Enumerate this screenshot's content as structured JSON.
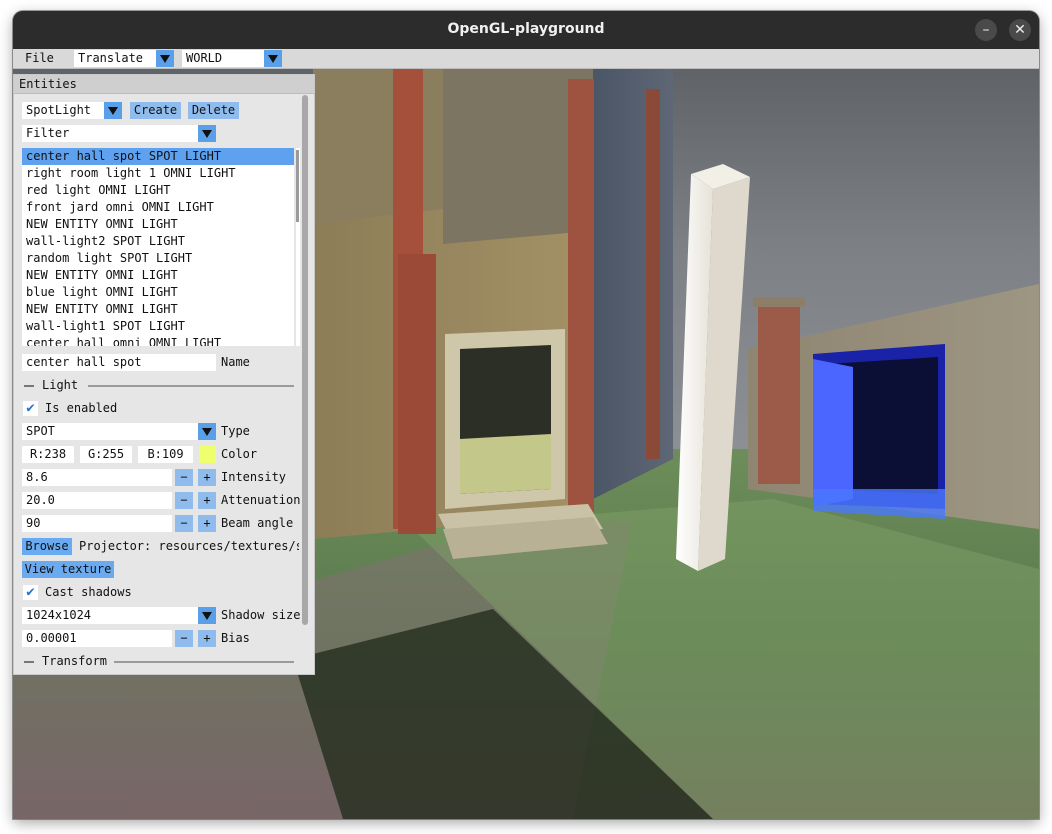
{
  "window": {
    "title": "OpenGL-playground",
    "minimize": "–",
    "close": "✕"
  },
  "menubar": {
    "file": "File",
    "mode": "Translate",
    "space": "WORLD"
  },
  "panel": {
    "title": "Entities",
    "entity_type": "SpotLight",
    "create": "Create",
    "delete": "Delete",
    "filter": "Filter",
    "entities": [
      "center hall spot SPOT LIGHT",
      "right room light 1 OMNI LIGHT",
      "red light OMNI LIGHT",
      "front jard omni OMNI LIGHT",
      "NEW ENTITY OMNI LIGHT",
      "wall-light2 SPOT LIGHT",
      "random light SPOT LIGHT",
      "NEW ENTITY OMNI LIGHT",
      "blue light OMNI LIGHT",
      "NEW ENTITY OMNI LIGHT",
      "wall-light1 SPOT LIGHT",
      "center hall omni OMNI LIGHT"
    ],
    "name_value": "center hall spot",
    "name_label": "Name",
    "light_section": "Light",
    "is_enabled": "Is enabled",
    "type_value": "SPOT",
    "type_label": "Type",
    "color_r": "R:238",
    "color_g": "G:255",
    "color_b": "B:109",
    "color_label": "Color",
    "color_hex": "#eeff6d",
    "intensity_value": "8.6",
    "intensity_label": "Intensity",
    "attenuation_value": "20.0",
    "attenuation_label": "Attenuation",
    "beam_value": "90",
    "beam_label": "Beam angle",
    "browse": "Browse",
    "projector": "Projector: resources/textures/sp",
    "view_texture": "View texture",
    "cast_shadows": "Cast shadows",
    "shadow_value": "1024x1024",
    "shadow_label": "Shadow size",
    "bias_value": "0.00001",
    "bias_label": "Bias",
    "transform_section": "Transform",
    "minus": "−",
    "plus": "+",
    "check": "✔"
  }
}
